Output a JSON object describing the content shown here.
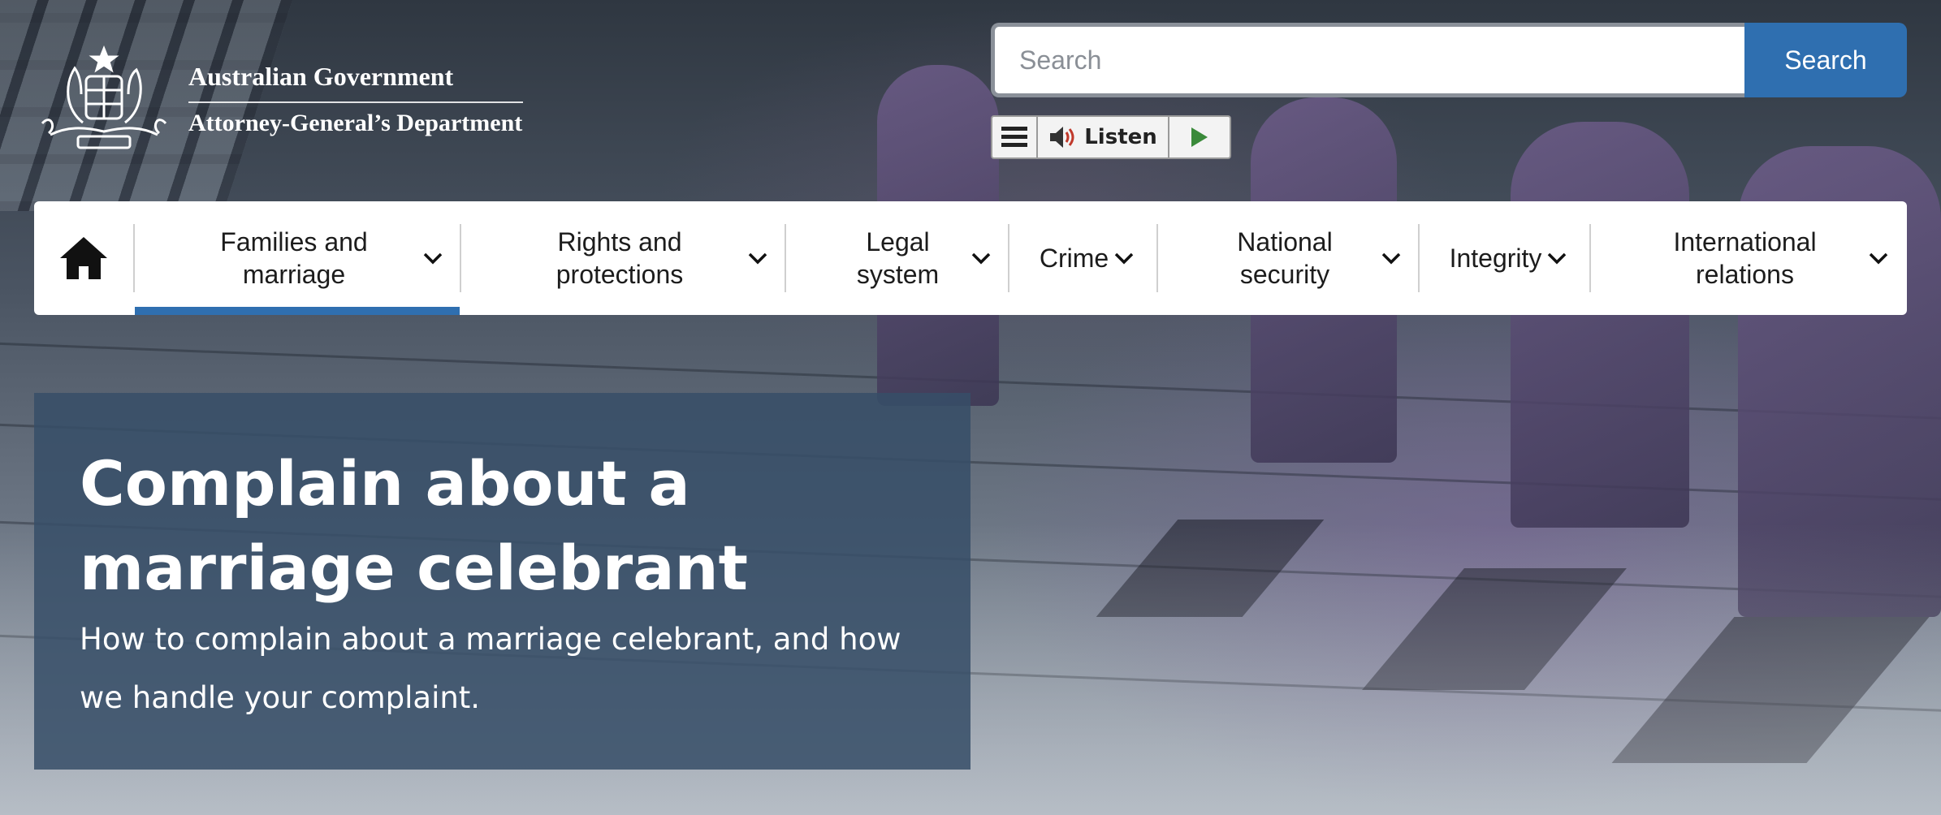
{
  "header": {
    "gov_name": "Australian Government",
    "dept_name": "Attorney-General’s Department"
  },
  "search": {
    "placeholder": "Search",
    "button_label": "Search"
  },
  "listen_bar": {
    "listen_label": "Listen"
  },
  "nav": {
    "active_index": 0,
    "items": [
      {
        "label": "Families and marriage",
        "icon": "chevron-down-icon"
      },
      {
        "label": "Rights and protections",
        "icon": "chevron-down-icon"
      },
      {
        "label": "Legal system",
        "icon": "chevron-down-icon"
      },
      {
        "label": "Crime",
        "icon": "chevron-down-icon"
      },
      {
        "label": "National security",
        "icon": "chevron-down-icon"
      },
      {
        "label": "Integrity",
        "icon": "chevron-down-icon"
      },
      {
        "label": "International relations",
        "icon": "chevron-down-icon"
      }
    ]
  },
  "hero": {
    "title": "Complain about a marriage celebrant",
    "subtitle": "How to complain about a marriage celebrant, and how we handle your complaint."
  },
  "colors": {
    "accent": "#2f6fb0",
    "hero_card": "#374e68",
    "play": "#3a8a3a"
  }
}
